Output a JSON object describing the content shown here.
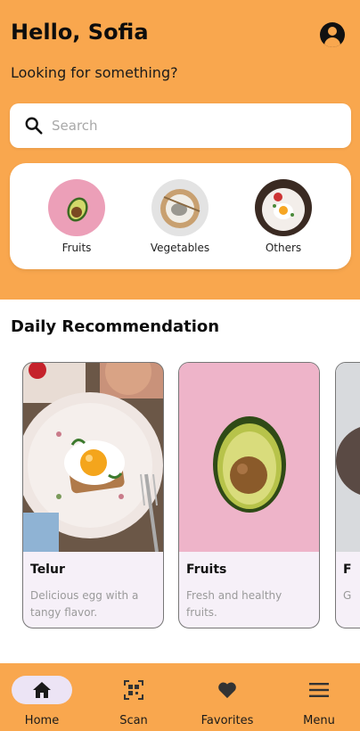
{
  "header": {
    "greeting": "Hello, Sofia",
    "subtitle": "Looking for something?",
    "profile_icon": "account-circle-icon"
  },
  "search": {
    "placeholder": "Search",
    "value": "",
    "icon": "search-icon"
  },
  "categories": [
    {
      "label": "Fruits",
      "icon": "avocado-image"
    },
    {
      "label": "Vegetables",
      "icon": "vegetable-bowl-image"
    },
    {
      "label": "Others",
      "icon": "egg-plate-image"
    }
  ],
  "daily": {
    "title": "Daily Recommendation",
    "cards": [
      {
        "title": "Telur",
        "desc": "Delicious egg with a tangy flavor.",
        "image": "egg-toast-photo"
      },
      {
        "title": "Fruits",
        "desc": "Fresh and healthy fruits.",
        "image": "avocado-photo"
      },
      {
        "title": "F",
        "desc": "G",
        "image": "partial-card"
      }
    ]
  },
  "nav": [
    {
      "label": "Home",
      "icon": "home-icon",
      "active": true
    },
    {
      "label": "Scan",
      "icon": "qr-scan-icon",
      "active": false
    },
    {
      "label": "Favorites",
      "icon": "heart-icon",
      "active": false
    },
    {
      "label": "Menu",
      "icon": "menu-icon",
      "active": false
    }
  ],
  "colors": {
    "accent": "#f9a74e",
    "card_background": "#f6f0f8",
    "active_pill": "#ece4f5"
  }
}
